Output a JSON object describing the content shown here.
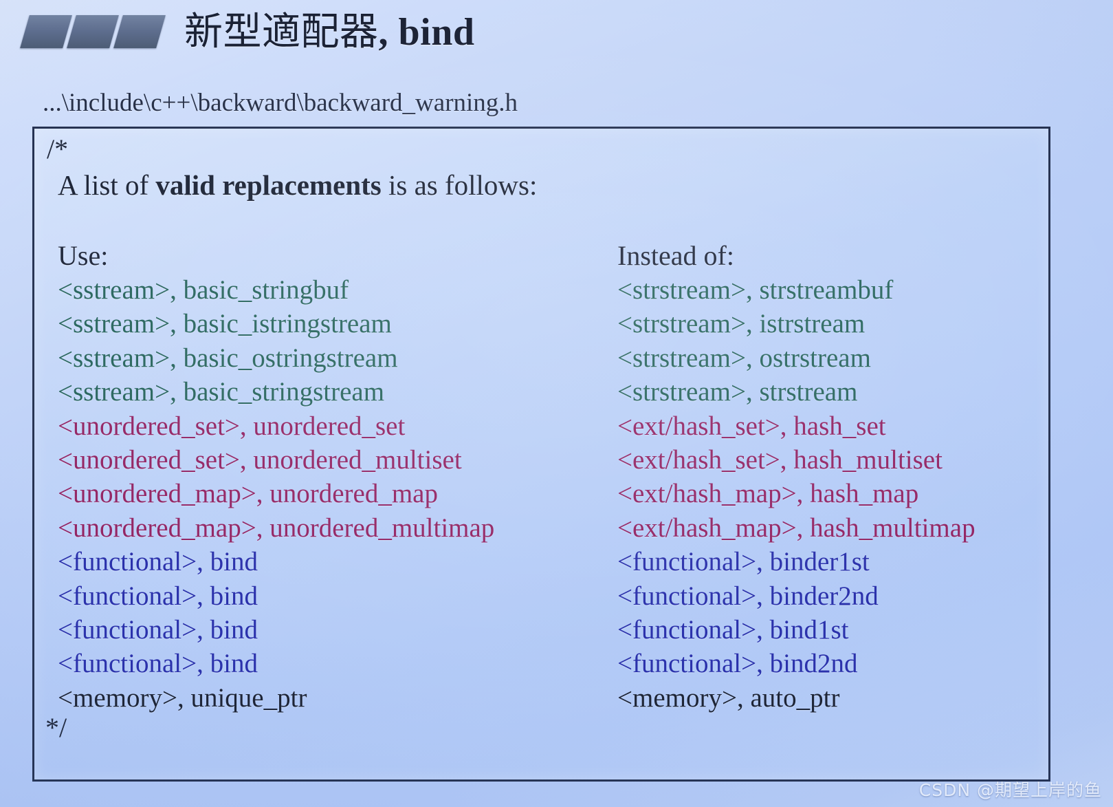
{
  "header": {
    "title_cjk": "新型適配器",
    "title_latin": ", bind",
    "decoration_icon": "parallelogram-blocks-icon"
  },
  "file_path": "...\\include\\c++\\backward\\backward_warning.h",
  "comment_block": {
    "open_token": "/*",
    "close_token": "*/",
    "intro_prefix": "A list of ",
    "intro_emphasis": "valid replacements",
    "intro_suffix": " is as follows:",
    "columns": {
      "use_header": "Use:",
      "instead_header": "Instead of:"
    },
    "rows": [
      {
        "use": "<sstream>, basic_stringbuf",
        "instead": "<strstream>, strstreambuf",
        "color_group": "c-stream"
      },
      {
        "use": "<sstream>, basic_istringstream",
        "instead": "<strstream>, istrstream",
        "color_group": "c-stream"
      },
      {
        "use": "<sstream>, basic_ostringstream",
        "instead": "<strstream>, ostrstream",
        "color_group": "c-stream"
      },
      {
        "use": "<sstream>, basic_stringstream",
        "instead": "<strstream>, strstream",
        "color_group": "c-stream"
      },
      {
        "use": "<unordered_set>, unordered_set",
        "instead": "<ext/hash_set>, hash_set",
        "color_group": "c-hash"
      },
      {
        "use": "<unordered_set>, unordered_multiset",
        "instead": "<ext/hash_set>, hash_multiset",
        "color_group": "c-hash"
      },
      {
        "use": "<unordered_map>, unordered_map",
        "instead": "<ext/hash_map>, hash_map",
        "color_group": "c-hash"
      },
      {
        "use": "<unordered_map>, unordered_multimap",
        "instead": "<ext/hash_map>, hash_multimap",
        "color_group": "c-hash"
      },
      {
        "use": "<functional>, bind",
        "instead": "<functional>, binder1st",
        "color_group": "c-func"
      },
      {
        "use": "<functional>, bind",
        "instead": "<functional>, binder2nd",
        "color_group": "c-func"
      },
      {
        "use": "<functional>, bind",
        "instead": "<functional>, bind1st",
        "color_group": "c-func"
      },
      {
        "use": "<functional>, bind",
        "instead": "<functional>, bind2nd",
        "color_group": "c-func"
      },
      {
        "use": "<memory>, unique_ptr",
        "instead": "<memory>, auto_ptr",
        "color_group": "c-mem"
      }
    ]
  },
  "watermark": "CSDN @期望上岸的鱼",
  "colors": {
    "background_top": "#dbe6fb",
    "background_bottom": "#c3d6f9",
    "box_border": "#1d2a4a",
    "deco_block": "#59698a",
    "stream_text": "#1f5f57",
    "hash_text": "#8f1c5e",
    "functional_text": "#2229a8",
    "memory_text": "#141b2c",
    "title_text": "#11182c"
  }
}
